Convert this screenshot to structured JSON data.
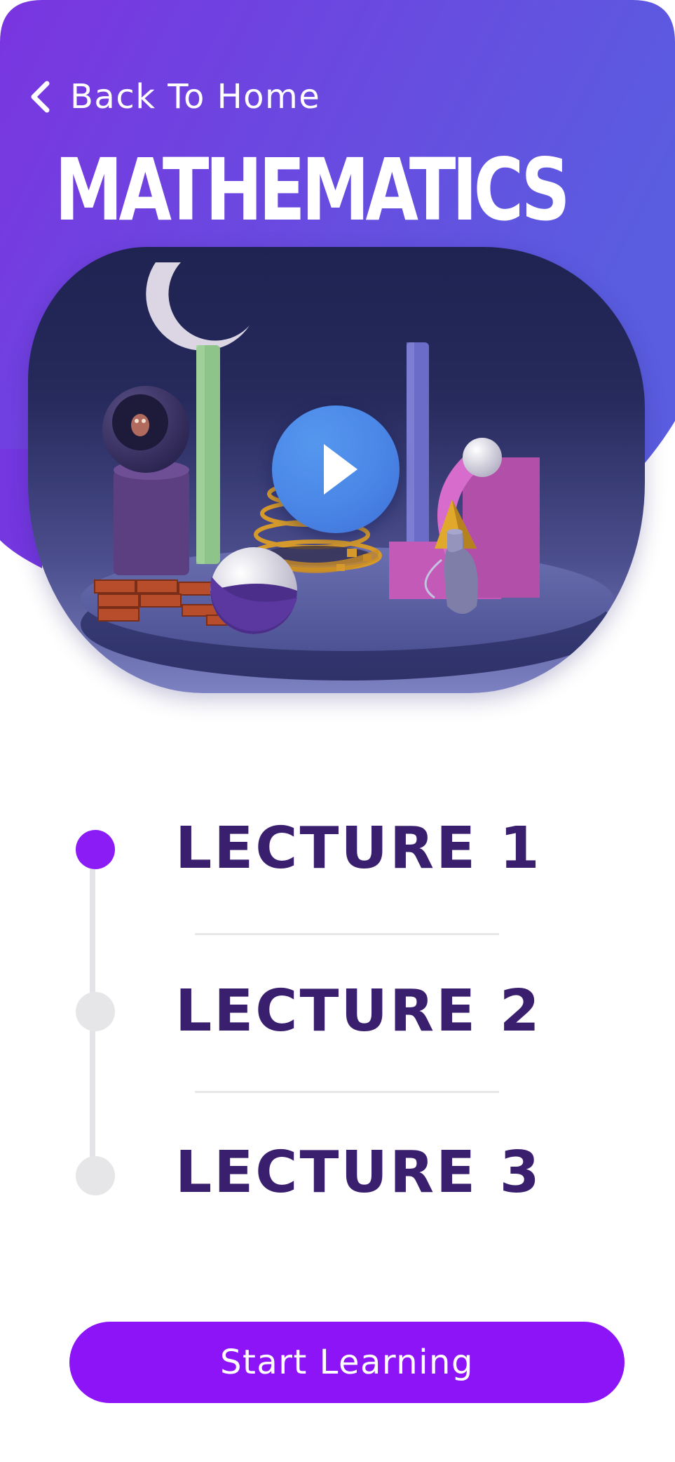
{
  "header": {
    "back_label": "Back To Home",
    "title": "MATHEMATICS"
  },
  "video": {
    "play_icon": "play-icon"
  },
  "lectures": [
    {
      "label": "LECTURE 1",
      "active": true
    },
    {
      "label": "LECTURE 2",
      "active": false
    },
    {
      "label": "LECTURE 3",
      "active": false
    }
  ],
  "cta": {
    "label": "Start Learning"
  },
  "colors": {
    "header_gradient_start": "#7a35e0",
    "header_gradient_end": "#5a5de0",
    "accent": "#8c14f7",
    "lecture_text": "#3a1f6e",
    "inactive_dot": "#e6e6e9",
    "play_button": "#4a86e6"
  }
}
